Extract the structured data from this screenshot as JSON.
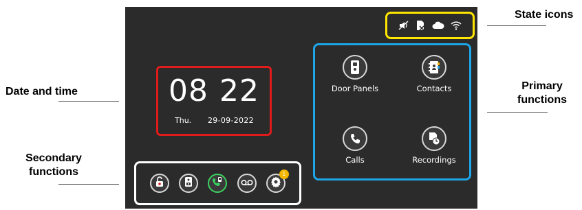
{
  "annotations": {
    "state_icons": "State icons",
    "date_and_time": "Date and time",
    "primary_functions_line1": "Primary",
    "primary_functions_line2": "functions",
    "secondary_functions_line1": "Secondary",
    "secondary_functions_line2": "functions"
  },
  "colors": {
    "screen_bg": "#2b2b2b",
    "state_frame": "#ffe600",
    "datetime_frame": "#e01b1b",
    "primary_frame": "#1ea6e8",
    "secondary_frame": "#ffffff",
    "call_accent": "#3bd160",
    "badge": "#f5b700"
  },
  "state_icons": [
    "speaker-muted-icon",
    "sd-card-missing-icon",
    "cloud-icon",
    "wifi-icon"
  ],
  "datetime": {
    "hours": "08",
    "minutes": "22",
    "weekday": "Thu.",
    "date": "29-09-2022"
  },
  "primary": {
    "door_panels": "Door Panels",
    "contacts": "Contacts",
    "calls": "Calls",
    "recordings": "Recordings"
  },
  "secondary": {
    "icons": [
      "unlock-icon",
      "camera-snapshot-icon",
      "intercom-call-icon",
      "voicemail-icon",
      "settings-icon"
    ],
    "settings_badge": "1"
  }
}
